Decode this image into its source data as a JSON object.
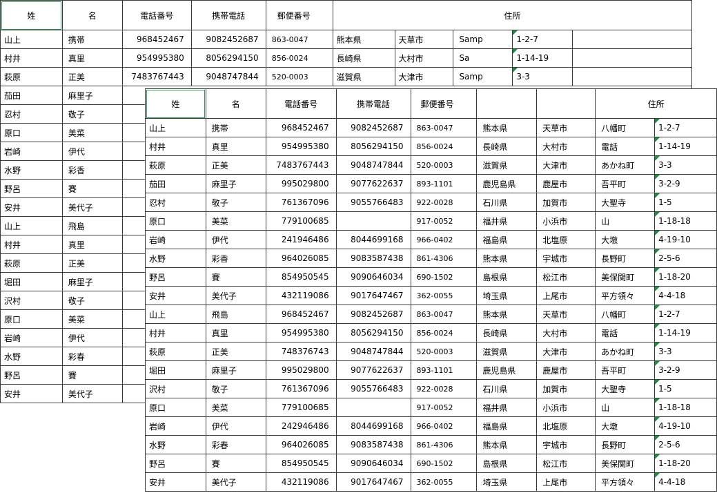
{
  "headers": [
    "姓",
    "名",
    "電話番号",
    "携帯電話",
    "郵便番号",
    "住所"
  ],
  "back_rows": [
    {
      "last": "山上",
      "first": "携帯",
      "tel": "968452467",
      "mobile": "9082452687",
      "zip": "863-0047",
      "pref": "熊本県",
      "city": "天草市",
      "town": "Samp",
      "addr": "1-2-7"
    },
    {
      "last": "村井",
      "first": "真里",
      "tel": "954995380",
      "mobile": "8056294150",
      "zip": "856-0024",
      "pref": "長崎県",
      "city": "大村市",
      "town": "Sa",
      "addr": "1-14-19"
    },
    {
      "last": "萩原",
      "first": "正美",
      "tel": "7483767443",
      "mobile": "9048747844",
      "zip": "520-0003",
      "pref": "滋賀県",
      "city": "大津市",
      "town": "Samp",
      "addr": "3-3"
    },
    {
      "last": "茄田",
      "first": "麻里子"
    },
    {
      "last": "忍村",
      "first": "敬子"
    },
    {
      "last": "原口",
      "first": "美菜"
    },
    {
      "last": "岩崎",
      "first": "伊代"
    },
    {
      "last": "水野",
      "first": "彩香"
    },
    {
      "last": "野呂",
      "first": "賽"
    },
    {
      "last": "安井",
      "first": "美代子"
    },
    {
      "last": "山上",
      "first": "飛島"
    },
    {
      "last": "村井",
      "first": "真里"
    },
    {
      "last": "萩原",
      "first": "正美"
    },
    {
      "last": "堀田",
      "first": "麻里子"
    },
    {
      "last": "沢村",
      "first": "敬子"
    },
    {
      "last": "原口",
      "first": "美菜"
    },
    {
      "last": "岩崎",
      "first": "伊代"
    },
    {
      "last": "水野",
      "first": "彩春"
    },
    {
      "last": "野呂",
      "first": "賽"
    },
    {
      "last": "安井",
      "first": "美代子"
    }
  ],
  "front_rows": [
    {
      "last": "山上",
      "first": "携帯",
      "tel": "968452467",
      "mobile": "9082452687",
      "zip": "863-0047",
      "pref": "熊本県",
      "city": "天草市",
      "town": "八幡町",
      "addr": "1-2-7"
    },
    {
      "last": "村井",
      "first": "真里",
      "tel": "954995380",
      "mobile": "8056294150",
      "zip": "856-0024",
      "pref": "長崎県",
      "city": "大村市",
      "town": "電話",
      "addr": "1-14-19"
    },
    {
      "last": "萩原",
      "first": "正美",
      "tel": "7483767443",
      "mobile": "9048747844",
      "zip": "520-0003",
      "pref": "滋賀県",
      "city": "大津市",
      "town": "あかね町",
      "addr": "3-3"
    },
    {
      "last": "茄田",
      "first": "麻里子",
      "tel": "995029800",
      "mobile": "9077622637",
      "zip": "893-1101",
      "pref": "鹿児島県",
      "city": "鹿屋市",
      "town": "吾平町",
      "addr": "3-2-9"
    },
    {
      "last": "忍村",
      "first": "敬子",
      "tel": "761367096",
      "mobile": "9055766483",
      "zip": "922-0028",
      "pref": "石川県",
      "city": "加賀市",
      "town": "大聖寺",
      "addr": "1-5"
    },
    {
      "last": "原口",
      "first": "美菜",
      "tel": "779100685",
      "mobile": "",
      "zip": "917-0052",
      "pref": "福井県",
      "city": "小浜市",
      "town": "山",
      "addr": "1-18-18"
    },
    {
      "last": "岩崎",
      "first": "伊代",
      "tel": "241946486",
      "mobile": "8044699168",
      "zip": "966-0402",
      "pref": "福島県",
      "city": "北塩原",
      "town": "大墩",
      "addr": "4-19-10"
    },
    {
      "last": "水野",
      "first": "彩香",
      "tel": "964026085",
      "mobile": "9083587438",
      "zip": "861-4306",
      "pref": "熊本県",
      "city": "宇城市",
      "town": "長野町",
      "addr": "2-5-6"
    },
    {
      "last": "野呂",
      "first": "賽",
      "tel": "854950545",
      "mobile": "9090646034",
      "zip": "690-1502",
      "pref": "島根県",
      "city": "松江市",
      "town": "美保関町",
      "addr": "1-18-20"
    },
    {
      "last": "安井",
      "first": "美代子",
      "tel": "432119086",
      "mobile": "9017647467",
      "zip": "362-0055",
      "pref": "埼玉県",
      "city": "上尾市",
      "town": "平方領々",
      "addr": "4-4-18"
    },
    {
      "last": "山上",
      "first": "飛島",
      "tel": "968452467",
      "mobile": "9082452687",
      "zip": "863-0047",
      "pref": "熊本県",
      "city": "天草市",
      "town": "八幡町",
      "addr": "1-2-7"
    },
    {
      "last": "村井",
      "first": "真里",
      "tel": "954995380",
      "mobile": "8056294150",
      "zip": "856-0024",
      "pref": "長崎県",
      "city": "大村市",
      "town": "電話",
      "addr": "1-14-19"
    },
    {
      "last": "萩原",
      "first": "正美",
      "tel": "748376743",
      "mobile": "9048747844",
      "zip": "520-0003",
      "pref": "滋賀県",
      "city": "大津市",
      "town": "あかね町",
      "addr": "3-3"
    },
    {
      "last": "堀田",
      "first": "麻里子",
      "tel": "995029800",
      "mobile": "9077622637",
      "zip": "893-1101",
      "pref": "鹿児島県",
      "city": "鹿屋市",
      "town": "吾平町",
      "addr": "3-2-9"
    },
    {
      "last": "沢村",
      "first": "敬子",
      "tel": "761367096",
      "mobile": "9055766483",
      "zip": "922-0028",
      "pref": "石川県",
      "city": "加賀市",
      "town": "大聖寺",
      "addr": "1-5"
    },
    {
      "last": "原口",
      "first": "美菜",
      "tel": "779100685",
      "mobile": "",
      "zip": "917-0052",
      "pref": "福井県",
      "city": "小浜市",
      "town": "山",
      "addr": "1-18-18"
    },
    {
      "last": "岩崎",
      "first": "伊代",
      "tel": "242946486",
      "mobile": "8044699168",
      "zip": "966-0402",
      "pref": "福島県",
      "city": "北塩原",
      "town": "大墩",
      "addr": "4-19-10"
    },
    {
      "last": "水野",
      "first": "彩春",
      "tel": "964026085",
      "mobile": "9083587438",
      "zip": "861-4306",
      "pref": "熊本県",
      "city": "宇城市",
      "town": "長野町",
      "addr": "2-5-6"
    },
    {
      "last": "野呂",
      "first": "賽",
      "tel": "854950545",
      "mobile": "9090646034",
      "zip": "690-1502",
      "pref": "島根県",
      "city": "松江市",
      "town": "美保関町",
      "addr": "1-18-20"
    },
    {
      "last": "安井",
      "first": "美代子",
      "tel": "432119086",
      "mobile": "9017647467",
      "zip": "362-0055",
      "pref": "埼玉県",
      "city": "上尾市",
      "town": "平方領々",
      "addr": "4-4-18"
    }
  ],
  "colors": {
    "grid": "#3a3a3a",
    "selection": "#2e9a5a",
    "note_marker": "#1e8a46"
  }
}
